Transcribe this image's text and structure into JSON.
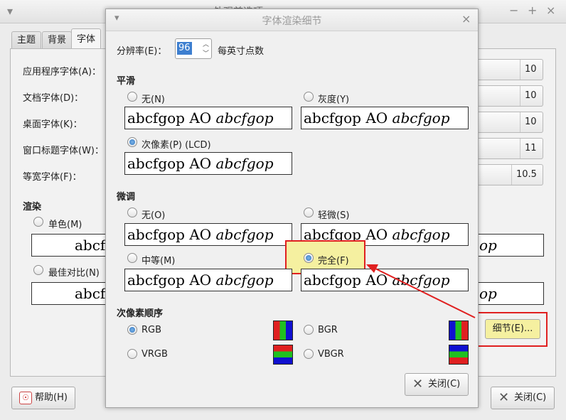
{
  "bg_window": {
    "title": "外观首选项",
    "tabs": [
      "主题",
      "背景",
      "字体"
    ],
    "active_tab": "字体",
    "font_rows": [
      {
        "label": "应用程序字体(A)：",
        "size": "10"
      },
      {
        "label": "文档字体(D)：",
        "size": "10"
      },
      {
        "label": "桌面字体(K)：",
        "size": "10"
      },
      {
        "label": "窗口标题字体(W)：",
        "size": "11"
      },
      {
        "label": "等宽字体(F)：",
        "size": "10.5"
      }
    ],
    "render_heading": "渲染",
    "render_options": [
      {
        "label": "单色(M)",
        "preview_left": "abcf",
        "preview_right": "op"
      },
      {
        "label": "最佳对比(N)",
        "preview_left": "abcf",
        "preview_right": "op"
      }
    ],
    "details_button": "细节(E)...",
    "help_button": "帮助(H)",
    "close_button": "关闭(C)"
  },
  "dialog": {
    "title": "字体渲染细节",
    "resolution_label": "分辨率(E)：",
    "resolution_value": "96",
    "resolution_unit": "每英寸点数",
    "smoothing_heading": "平滑",
    "smoothing_options": [
      {
        "label": "无(N)",
        "checked": false
      },
      {
        "label": "灰度(Y)",
        "checked": false
      },
      {
        "label": "次像素(P) (LCD)",
        "checked": true
      }
    ],
    "hinting_heading": "微调",
    "hinting_options": [
      {
        "label": "无(O)",
        "checked": false
      },
      {
        "label": "轻微(S)",
        "checked": false
      },
      {
        "label": "中等(M)",
        "checked": false
      },
      {
        "label": "完全(F)",
        "checked": true
      }
    ],
    "subpixel_heading": "次像素顺序",
    "subpixel_options": [
      {
        "label": "RGB",
        "checked": true
      },
      {
        "label": "BGR",
        "checked": false
      },
      {
        "label": "VRGB",
        "checked": false
      },
      {
        "label": "VBGR",
        "checked": false
      }
    ],
    "preview_regular": "abcfgop AO",
    "preview_italic": "abcfgop",
    "close_button": "关闭(C)"
  },
  "colors": {
    "red": "#e02020",
    "green": "#20c020",
    "blue": "#1010d0",
    "highlight": "#f5f0a0"
  }
}
